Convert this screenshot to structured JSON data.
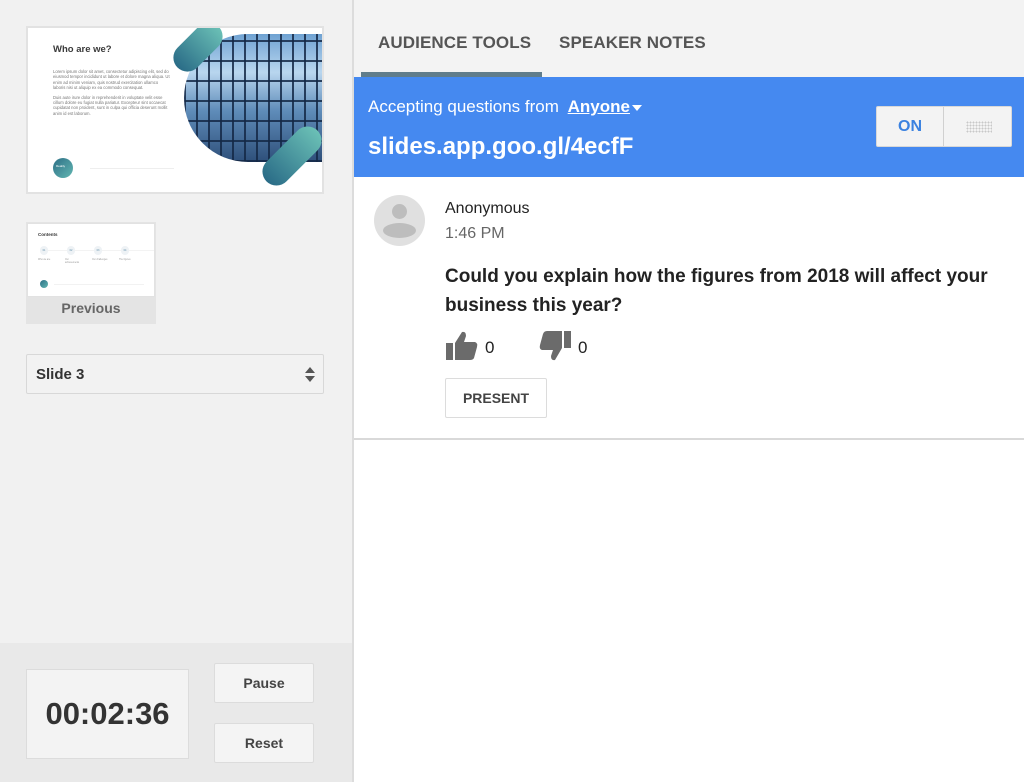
{
  "left_panel": {
    "current_slide": {
      "title": "Who are we?",
      "paragraphs": [
        "Lorem ipsum dolor sit amet, consectetur adipiscing elit, sed do eiusmod tempor incididunt ut labore et dolore magna aliqua. Ut enim ad minim veniam, quis nostrud exercitation ullamco laboris nisi ut aliquip ex ea commodo consequat.",
        "Duis aute irure dolor in reprehenderit in voluptate velit esse cillum dolore eu fugiat nulla pariatur. Excepteur sint occaecat cupidatat non proident, sunt in culpa qui officia deserunt mollit anim id est laborum."
      ],
      "logo_text": "Reality"
    },
    "previous_slide": {
      "title": "Contents",
      "items": [
        {
          "num": "01",
          "caption": "Who we are"
        },
        {
          "num": "02",
          "caption": "Our achievements"
        },
        {
          "num": "03",
          "caption": "Our challenges"
        },
        {
          "num": "04",
          "caption": "The figures"
        }
      ],
      "label": "Previous"
    },
    "slide_select": {
      "value": "Slide 3"
    },
    "timer": {
      "value": "00:02:36",
      "pause_label": "Pause",
      "reset_label": "Reset"
    }
  },
  "right_panel": {
    "tabs": [
      {
        "label": "AUDIENCE TOOLS",
        "active": true
      },
      {
        "label": "SPEAKER NOTES",
        "active": false
      }
    ],
    "banner": {
      "accepting_label": "Accepting questions from",
      "audience_option": "Anyone",
      "url": "slides.app.goo.gl/4ecfF",
      "toggle_label": "ON",
      "toggle_state": "on",
      "color": "#4589f0"
    },
    "question": {
      "author": "Anonymous",
      "time": "1:46 PM",
      "text": "Could you explain how the figures from 2018 will affect your business this year?",
      "upvotes": "0",
      "downvotes": "0",
      "present_label": "PRESENT"
    }
  }
}
